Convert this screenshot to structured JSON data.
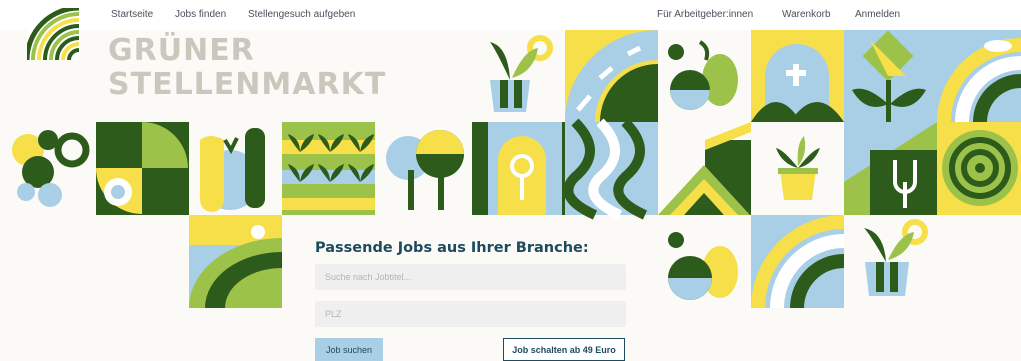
{
  "nav": {
    "home": "Startseite",
    "find_jobs": "Jobs finden",
    "post_request": "Stellengesuch aufgeben",
    "employers": "Für Arbeitgeber:innen",
    "cart": "Warenkorb",
    "login": "Anmelden"
  },
  "brand": {
    "line1": "GRÜNER",
    "line2": "STELLENMARKT"
  },
  "search": {
    "title": "Passende Jobs aus Ihrer Branche:",
    "job_placeholder": "Suche nach Jobtitel...",
    "zip_placeholder": "PLZ",
    "search_button": "Job suchen",
    "post_button": "Job schalten ab 49 Euro"
  },
  "colors": {
    "dark_green": "#2c5b1c",
    "light_green": "#9cc24a",
    "yellow": "#f7df4a",
    "light_blue": "#a9cfe6",
    "cream": "#fbfaf6",
    "navy": "#1e4a5f"
  }
}
